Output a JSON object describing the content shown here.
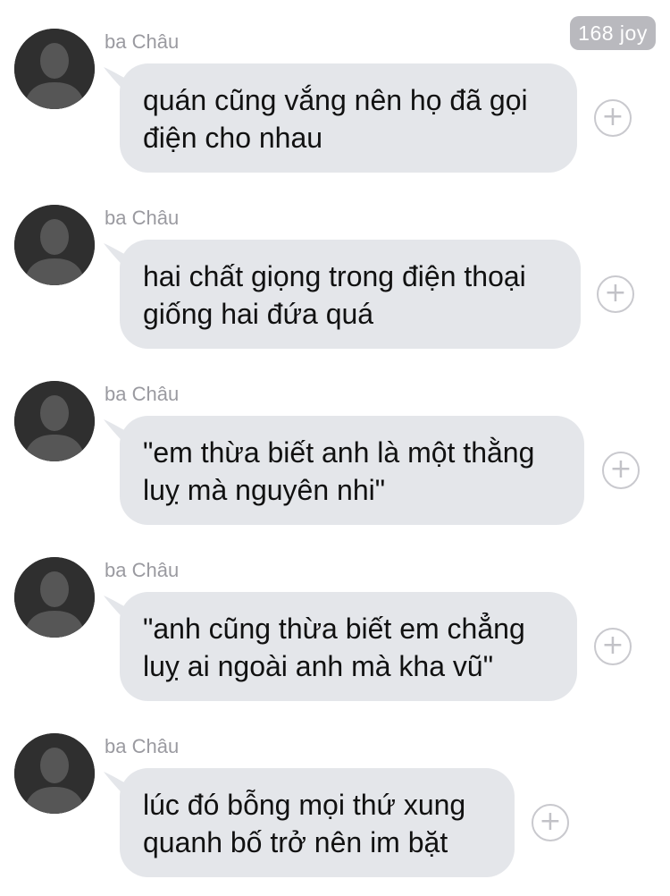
{
  "badge": {
    "label": "168 joy"
  },
  "messages": [
    {
      "sender": "ba Châu",
      "text": "quán cũng vắng nên họ đã gọi\nđiện cho nhau",
      "add_icon": "plus-circle-icon"
    },
    {
      "sender": "ba Châu",
      "text": "hai chất giọng trong điện thoại\ngiống hai đứa quá",
      "add_icon": "plus-circle-icon"
    },
    {
      "sender": "ba Châu",
      "text": "\"em thừa biết anh là một thằng\nluỵ mà nguyên nhi\"",
      "add_icon": "plus-circle-icon"
    },
    {
      "sender": "ba Châu",
      "text": "\"anh cũng thừa biết em chẳng\nluỵ ai ngoài anh mà kha vũ\"",
      "add_icon": "plus-circle-icon"
    },
    {
      "sender": "ba Châu",
      "text": "lúc đó bỗng mọi thứ xung\nquanh bố trở nên im bặt",
      "add_icon": "plus-circle-icon"
    }
  ],
  "colors": {
    "bubble": "#e4e6ea",
    "avatar": "#2f2f2f",
    "badge": "#b9b9be",
    "sender": "#9a9aa0"
  }
}
